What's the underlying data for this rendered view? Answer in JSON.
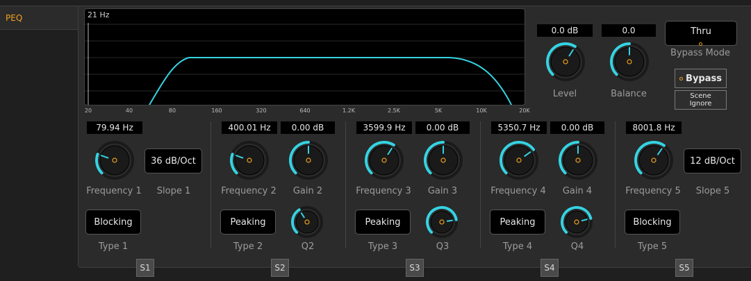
{
  "tab": {
    "label": "PEQ"
  },
  "graph": {
    "readout": "21 Hz",
    "x_ticks": [
      "20",
      "40",
      "80",
      "160",
      "320",
      "640",
      "1.2K",
      "2.5K",
      "5K",
      "10K",
      "20K"
    ]
  },
  "master": {
    "level": {
      "value": "0.0 dB",
      "label": "Level",
      "fraction": 0.62
    },
    "balance": {
      "value": "0.0",
      "label": "Balance",
      "fraction": 0.5
    },
    "bypass_mode": {
      "value": "Thru",
      "label": "Bypass Mode"
    },
    "bypass_button": "Bypass",
    "scene_ignore": {
      "line1": "Scene",
      "line2": "Ignore"
    }
  },
  "bands": [
    {
      "freq_value": "79.94 Hz",
      "freq_label": "Frequency 1",
      "freq_fraction": 0.24,
      "slope_value": "36 dB/Oct",
      "slope_label": "Slope 1",
      "type_value": "Blocking",
      "type_label": "Type 1",
      "switch": "S1"
    },
    {
      "freq_value": "400.01 Hz",
      "freq_label": "Frequency 2",
      "freq_fraction": 0.24,
      "gain_value": "0.00 dB",
      "gain_label": "Gain 2",
      "gain_fraction": 0.5,
      "q_label": "Q2",
      "q_fraction": 0.38,
      "type_value": "Peaking",
      "type_label": "Type 2",
      "switch": "S2"
    },
    {
      "freq_value": "3599.9 Hz",
      "freq_label": "Frequency 3",
      "freq_fraction": 0.62,
      "gain_value": "0.00 dB",
      "gain_label": "Gain 3",
      "gain_fraction": 0.5,
      "q_label": "Q3",
      "q_fraction": 0.8,
      "type_value": "Peaking",
      "type_label": "Type 3",
      "switch": "S3"
    },
    {
      "freq_value": "5350.7 Hz",
      "freq_label": "Frequency 4",
      "freq_fraction": 0.7,
      "gain_value": "0.00 dB",
      "gain_label": "Gain 4",
      "gain_fraction": 0.5,
      "q_label": "Q4",
      "q_fraction": 0.78,
      "type_value": "Peaking",
      "type_label": "Type 4",
      "switch": "S4"
    },
    {
      "freq_value": "8001.8 Hz",
      "freq_label": "Frequency 5",
      "freq_fraction": 0.63,
      "slope_value": "12 dB/Oct",
      "slope_label": "Slope 5",
      "type_value": "Blocking",
      "type_label": "Type 5",
      "switch": "S5"
    }
  ],
  "colors": {
    "accent": "#35d3e3",
    "indicator": "#f0a21c",
    "label": "#9c9c9c"
  }
}
